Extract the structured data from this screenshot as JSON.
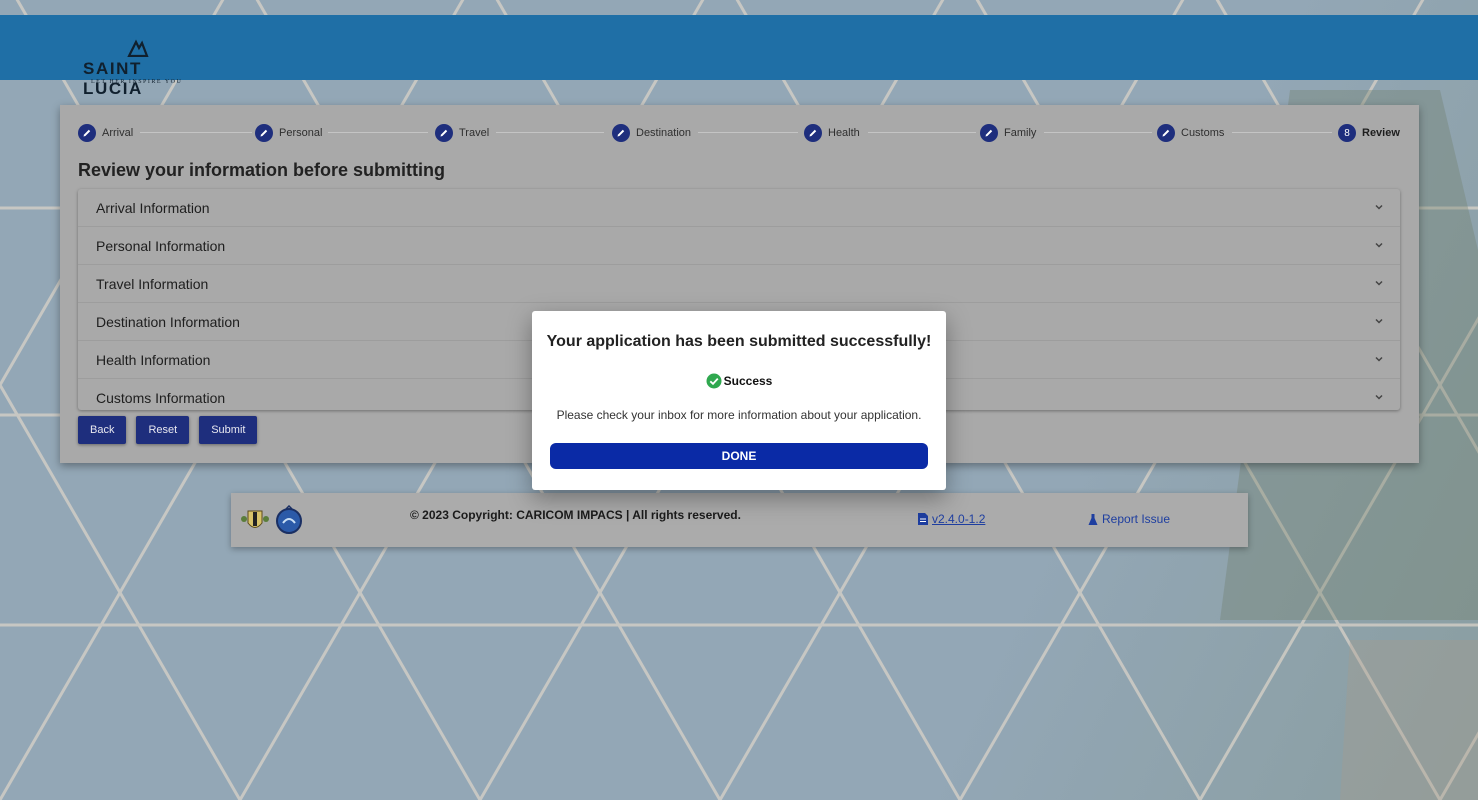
{
  "brand": {
    "name": "SAINT LUCIA",
    "tagline": "LET HER INSPIRE YOU"
  },
  "stepper": {
    "steps": [
      {
        "label": "Arrival",
        "icon": "pencil-icon",
        "done": true
      },
      {
        "label": "Personal",
        "icon": "pencil-icon",
        "done": true
      },
      {
        "label": "Travel",
        "icon": "pencil-icon",
        "done": true
      },
      {
        "label": "Destination",
        "icon": "pencil-icon",
        "done": true
      },
      {
        "label": "Health",
        "icon": "pencil-icon",
        "done": true
      },
      {
        "label": "Family",
        "icon": "pencil-icon",
        "done": true
      },
      {
        "label": "Customs",
        "icon": "pencil-icon",
        "done": true
      },
      {
        "label": "Review",
        "number": "8",
        "active": true
      }
    ]
  },
  "review": {
    "title": "Review your information before submitting",
    "sections": [
      "Arrival Information",
      "Personal Information",
      "Travel Information",
      "Destination Information",
      "Health Information",
      "Customs Information"
    ],
    "buttons": {
      "back": "Back",
      "reset": "Reset",
      "submit": "Submit"
    }
  },
  "footer": {
    "copyright": "© 2023 Copyright: CARICOM IMPACS | All rights reserved.",
    "version": "v2.4.0-1.2",
    "report": "Report Issue"
  },
  "modal": {
    "title": "Your application has been submitted successfully!",
    "status": "Success",
    "message": "Please check your inbox for more information about your application.",
    "done_label": "DONE"
  },
  "colors": {
    "header": "#1f6fa6",
    "primary": "#1e2e7d",
    "done_button": "#0a2aa6",
    "success_green": "#2fa84f"
  }
}
